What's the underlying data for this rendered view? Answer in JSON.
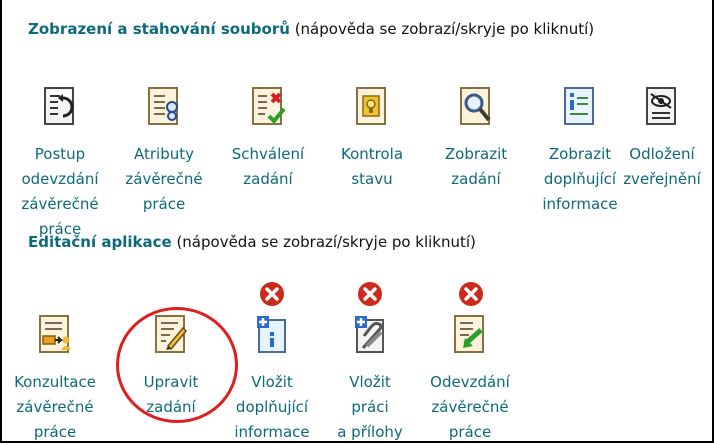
{
  "sections": {
    "download": {
      "title": "Zobrazení a stahování souborů",
      "hint": " (nápověda se zobrazí/skryje po kliknutí)"
    },
    "edit": {
      "title": "Editační aplikace",
      "hint": " (nápověda se zobrazí/skryje po kliknutí)"
    }
  },
  "download_items": [
    {
      "icon": "thesis-submission-progress-icon",
      "lines": [
        "Postup",
        "odevzdání",
        "závěrečné",
        "práce"
      ]
    },
    {
      "icon": "thesis-attributes-icon",
      "lines": [
        "Atributy",
        "závěrečné",
        "práce"
      ]
    },
    {
      "icon": "assignment-approval-icon",
      "lines": [
        "Schválení",
        "zadání"
      ]
    },
    {
      "icon": "status-check-icon",
      "lines": [
        "Kontrola",
        "stavu"
      ]
    },
    {
      "icon": "view-assignment-icon",
      "lines": [
        "Zobrazit",
        "zadání"
      ]
    },
    {
      "icon": "supplementary-info-icon",
      "lines": [
        "Zobrazit",
        "doplňující",
        "informace"
      ]
    },
    {
      "icon": "publication-deferral-icon",
      "lines": [
        "Odložení",
        "zveřejnění"
      ]
    }
  ],
  "edit_items": [
    {
      "icon": "thesis-consultations-icon",
      "lines": [
        "Konzultace",
        "závěrečné",
        "práce"
      ],
      "unavailable": false
    },
    {
      "icon": "edit-assignment-icon",
      "lines": [
        "Upravit",
        "zadání"
      ],
      "unavailable": false
    },
    {
      "icon": "insert-supplementary-info-icon",
      "lines": [
        "Vložit",
        "doplňující",
        "informace"
      ],
      "unavailable": true
    },
    {
      "icon": "insert-thesis-attachments-icon",
      "lines": [
        "Vložit",
        "práci",
        "a přílohy"
      ],
      "unavailable": true
    },
    {
      "icon": "submit-thesis-icon",
      "lines": [
        "Odevzdání",
        "závěrečné",
        "práce"
      ],
      "unavailable": true
    }
  ],
  "colors": {
    "link": "#0c6a7a",
    "highlight_circle": "#e01e1e",
    "unavailable_badge": "#cc2a1a"
  }
}
